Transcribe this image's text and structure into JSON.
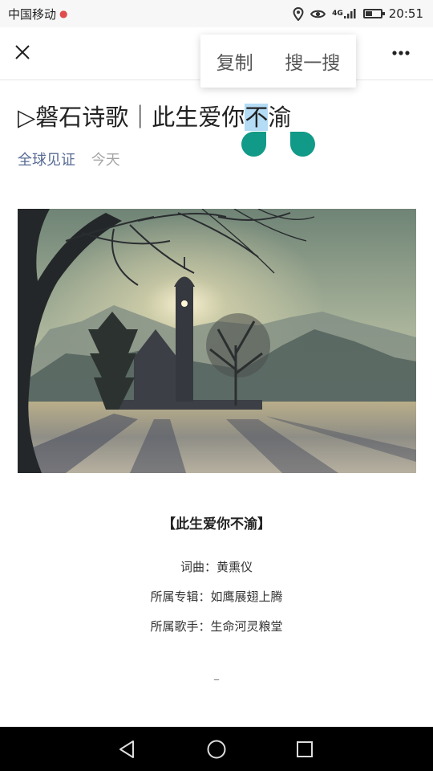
{
  "status_bar": {
    "carrier": "中国移动",
    "network": "4G",
    "time": "20:51",
    "battery_level": 0.45,
    "icons": [
      "location-dot-icon",
      "location-pin-icon",
      "eye-icon",
      "signal-icon",
      "battery-icon"
    ]
  },
  "top_bar": {
    "close_icon": "close-icon",
    "more_icon": "more-icon"
  },
  "context_menu": {
    "copy_label": "复制",
    "search_label": "搜一搜"
  },
  "article": {
    "title_prefix": "▷磐石诗歌｜此生爱你",
    "title_selected": "不",
    "title_suffix": "渝",
    "source": "全球见证",
    "date": "今天"
  },
  "body": {
    "poem_title": "【此生爱你不渝】",
    "lyricist": "词曲：黄熏仪",
    "album": "所属专辑：如鹰展翅上腾",
    "singer": "所属歌手：生命河灵粮堂",
    "divider": "–"
  },
  "nav_bar": {
    "icons": [
      "back-icon",
      "home-icon",
      "recents-icon"
    ]
  },
  "colors": {
    "selection": "#b4dcf5",
    "handle": "#119a87",
    "link": "#576b95",
    "muted": "#a6a6a6"
  }
}
